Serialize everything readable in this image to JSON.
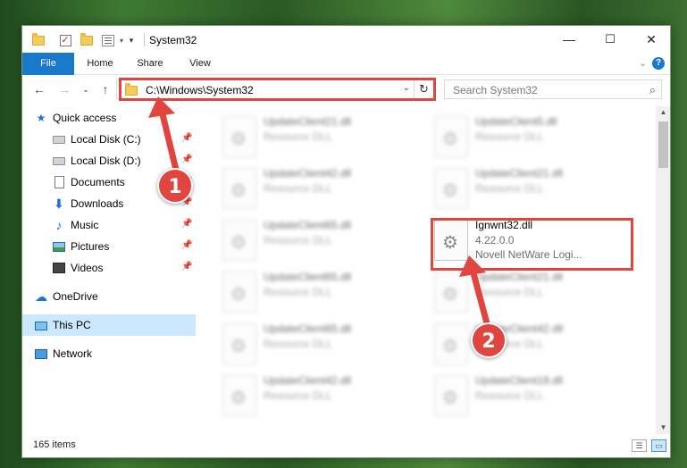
{
  "window": {
    "title": "System32",
    "controls": {
      "minimize": "—",
      "maximize": "☐",
      "close": "✕"
    }
  },
  "ribbon": {
    "tabs": [
      "File",
      "Home",
      "Share",
      "View"
    ],
    "help": "?"
  },
  "navbar": {
    "address": "C:\\Windows\\System32",
    "search_placeholder": "Search System32"
  },
  "sidebar": {
    "items": [
      {
        "label": "Quick access",
        "icon": "star-icon",
        "pinned": false
      },
      {
        "label": "Local Disk (C:)",
        "icon": "drive-icon",
        "pinned": true
      },
      {
        "label": "Local Disk (D:)",
        "icon": "drive-icon",
        "pinned": true
      },
      {
        "label": "Documents",
        "icon": "document-icon",
        "pinned": true
      },
      {
        "label": "Downloads",
        "icon": "download-icon",
        "pinned": true
      },
      {
        "label": "Music",
        "icon": "music-icon",
        "pinned": true
      },
      {
        "label": "Pictures",
        "icon": "pictures-icon",
        "pinned": true
      },
      {
        "label": "Videos",
        "icon": "video-icon",
        "pinned": true
      },
      {
        "label": "OneDrive",
        "icon": "cloud-icon",
        "pinned": false
      },
      {
        "label": "This PC",
        "icon": "computer-icon",
        "pinned": false,
        "selected": true
      },
      {
        "label": "Network",
        "icon": "network-icon",
        "pinned": false
      }
    ]
  },
  "files": {
    "column1": [
      {
        "name": "UpdateClient21.dll",
        "type": "Resource DLL"
      },
      {
        "name": "UpdateClient42.dll",
        "type": "Resource DLL"
      },
      {
        "name": "UpdateClient65.dll",
        "type": "Resource DLL"
      },
      {
        "name": "UpdateClient65.dll",
        "type": "Resource DLL"
      },
      {
        "name": "UpdateClient65.dll",
        "type": "Resource DLL"
      },
      {
        "name": "UpdateClient42.dll",
        "type": "Resource DLL"
      }
    ],
    "column2": [
      {
        "name": "UpdateClient5.dll",
        "type": "Resource DLL"
      },
      {
        "name": "UpdateClient21.dll",
        "type": "Resource DLL"
      },
      {
        "name": "UpdateClient21.dll",
        "type": "Resource DLL"
      },
      {
        "name": "UpdateClient42.dll",
        "type": "Resource DLL"
      },
      {
        "name": "UpdateClient19.dll",
        "type": "Resource DLL"
      }
    ],
    "highlighted": {
      "name": "Ignwnt32.dll",
      "version": "4.22.0.0",
      "description": "Novell NetWare Logi..."
    }
  },
  "status": {
    "item_count": "165 items"
  },
  "annotations": {
    "step1": "1",
    "step2": "2",
    "color": "#e0453f"
  }
}
